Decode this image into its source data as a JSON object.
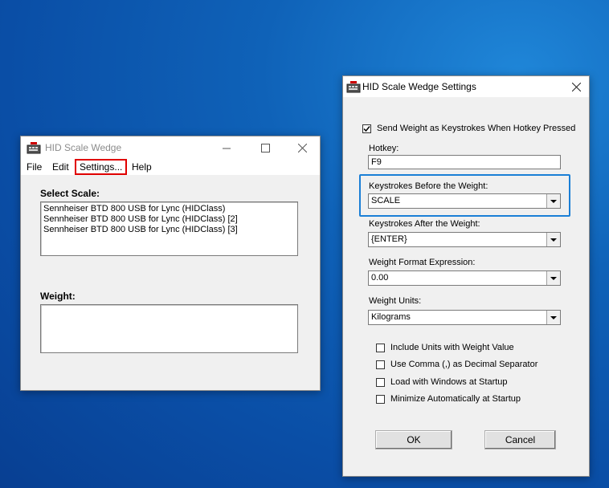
{
  "main_window": {
    "title": "HID Scale Wedge",
    "menu": [
      "File",
      "Edit",
      "Settings...",
      "Help"
    ],
    "select_scale_label": "Select Scale:",
    "scales": [
      "Sennheiser BTD 800 USB for Lync (HIDClass)",
      "Sennheiser BTD 800 USB for Lync (HIDClass) [2]",
      "Sennheiser BTD 800 USB for Lync (HIDClass) [3]"
    ],
    "weight_label": "Weight:",
    "weight_value": ""
  },
  "settings": {
    "title": "HID Scale Wedge Settings",
    "send_keystrokes_label": "Send Weight as Keystrokes When Hotkey Pressed",
    "send_keystrokes_checked": true,
    "hotkey_label": "Hotkey:",
    "hotkey_value": "F9",
    "before_label": "Keystrokes Before the Weight:",
    "before_value": "SCALE",
    "after_label": "Keystrokes After the Weight:",
    "after_value": "{ENTER}",
    "format_label": "Weight Format Expression:",
    "format_value": "0.00",
    "units_label": "Weight Units:",
    "units_value": "Kilograms",
    "options": [
      {
        "label": "Include Units with Weight Value",
        "checked": false
      },
      {
        "label": "Use Comma (,) as Decimal Separator",
        "checked": false
      },
      {
        "label": "Load with Windows at Startup",
        "checked": false
      },
      {
        "label": "Minimize Automatically at Startup",
        "checked": false
      }
    ],
    "ok_label": "OK",
    "cancel_label": "Cancel"
  },
  "colors": {
    "highlight_red": "#e00000",
    "highlight_blue": "#1a7fd6",
    "desktop_blue": "#0a4ea6"
  },
  "icons": {
    "app_icon": "keyboard-scale-icon",
    "close": "close-icon",
    "minimize": "minimize-icon",
    "maximize": "maximize-icon",
    "dropdown": "chevron-down-icon",
    "check": "checkmark-icon"
  }
}
